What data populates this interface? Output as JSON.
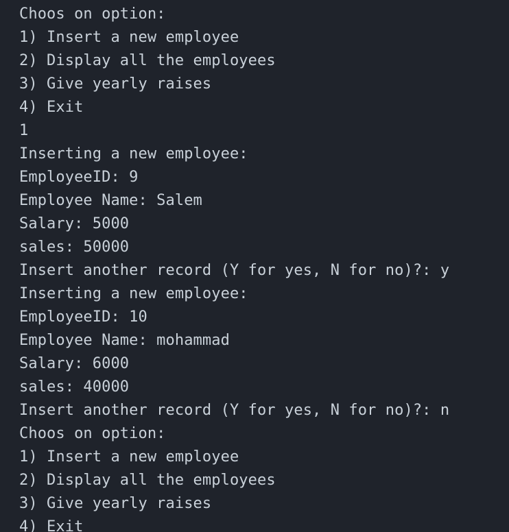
{
  "terminal": {
    "background": "#1f232b",
    "foreground": "#c9d1d9",
    "lines": [
      "Choos on option:",
      "1) Insert a new employee",
      "2) Display all the employees",
      "3) Give yearly raises",
      "4) Exit",
      "1",
      "Inserting a new employee:",
      "EmployeeID: 9",
      "Employee Name: Salem",
      "Salary: 5000",
      "sales: 50000",
      "Insert another record (Y for yes, N for no)?: y",
      "Inserting a new employee:",
      "EmployeeID: 10",
      "Employee Name: mohammad",
      "Salary: 6000",
      "sales: 40000",
      "Insert another record (Y for yes, N for no)?: n",
      "Choos on option:",
      "1) Insert a new employee",
      "2) Display all the employees",
      "3) Give yearly raises",
      "4) Exit"
    ]
  }
}
